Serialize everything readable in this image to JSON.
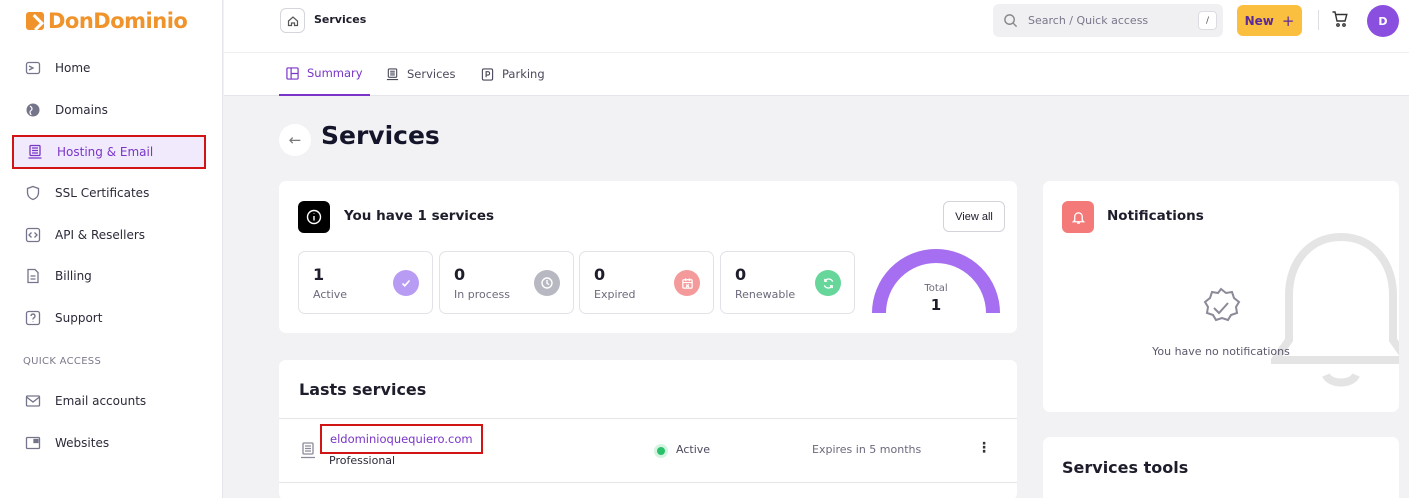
{
  "brand": {
    "name": "DonDominio",
    "color": "#f0932b"
  },
  "sidebar": {
    "items": [
      {
        "label": "Home",
        "icon": "home-icon"
      },
      {
        "label": "Domains",
        "icon": "globe-icon"
      },
      {
        "label": "Hosting & Email",
        "icon": "server-icon",
        "active": true
      },
      {
        "label": "SSL Certificates",
        "icon": "shield-icon"
      },
      {
        "label": "API & Resellers",
        "icon": "code-icon"
      },
      {
        "label": "Billing",
        "icon": "document-icon"
      },
      {
        "label": "Support",
        "icon": "help-icon"
      }
    ],
    "quick_access_label": "QUICK ACCESS",
    "quick_items": [
      {
        "label": "Email accounts",
        "icon": "mail-icon"
      },
      {
        "label": "Websites",
        "icon": "window-icon"
      }
    ]
  },
  "header": {
    "breadcrumb": "Services",
    "search_placeholder": "Search / Quick access",
    "search_shortcut": "/",
    "new_label": "New",
    "avatar_initial": "D",
    "accent": "#7a35c8"
  },
  "tabs": [
    {
      "label": "Summary",
      "active": true
    },
    {
      "label": "Services"
    },
    {
      "label": "Parking"
    }
  ],
  "page": {
    "title": "Services"
  },
  "summary": {
    "title": "You have 1 services",
    "view_all": "View all",
    "stats": [
      {
        "value": "1",
        "label": "Active",
        "color": "#b89cf3"
      },
      {
        "value": "0",
        "label": "In process",
        "color": "#b8b8c2"
      },
      {
        "value": "0",
        "label": "Expired",
        "color": "#f49a9a"
      },
      {
        "value": "0",
        "label": "Renewable",
        "color": "#66d69a"
      }
    ],
    "gauge": {
      "label": "Total",
      "value": "1",
      "fraction": 1.0,
      "color": "#a66ef0"
    }
  },
  "lasts": {
    "title": "Lasts services",
    "rows": [
      {
        "domain": "eldominioquequiero.com",
        "plan": "Professional",
        "status": "Active",
        "expires": "Expires in 5 months"
      }
    ]
  },
  "notifications": {
    "title": "Notifications",
    "empty": "You have no notifications"
  },
  "tools": {
    "title": "Services tools"
  }
}
